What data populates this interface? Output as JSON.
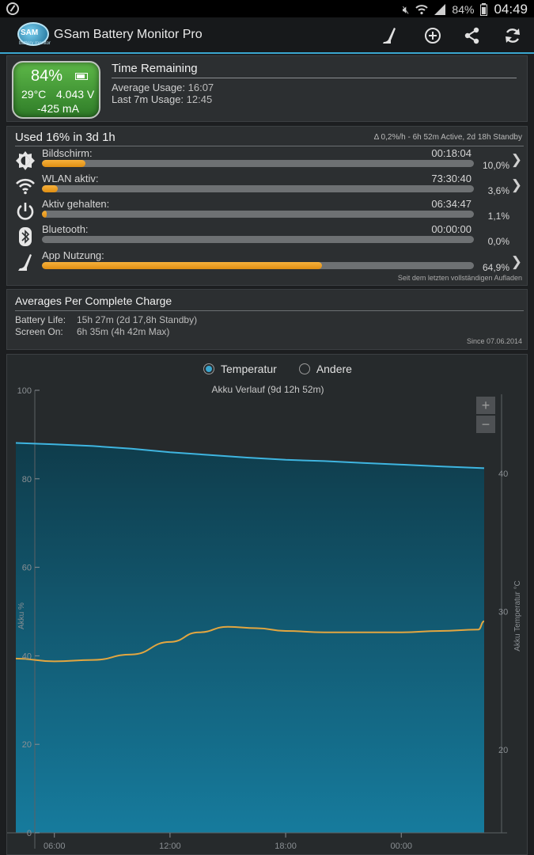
{
  "status_bar": {
    "battery": "84%",
    "time": "04:49"
  },
  "header": {
    "app_title": "GSam Battery Monitor Pro",
    "logo_text": "SAM",
    "logo_subtext": "battery monitor"
  },
  "battery_card": {
    "percent": "84%",
    "temperature": "29°C",
    "voltage": "4.043 V",
    "current": "-425 mA",
    "level": 0.84
  },
  "time_remaining": {
    "title": "Time Remaining",
    "rows": [
      {
        "label": "Average Usage:",
        "value": "16:07"
      },
      {
        "label": "Last 7m Usage:",
        "value": "12:45"
      }
    ]
  },
  "usage": {
    "title": "Used 16% in 3d 1h",
    "info": "Δ 0,2%/h - 6h 52m Active, 2d 18h Standby",
    "footer": "Seit dem letzten vollständigen Aufladen",
    "items": [
      {
        "icon": "screen-brightness-icon",
        "label": "Bildschirm:",
        "time": "00:18:04",
        "percent": "10,0%",
        "value": 10.0,
        "chevron": true
      },
      {
        "icon": "wifi-icon",
        "label": "WLAN aktiv:",
        "time": "73:30:40",
        "percent": "3,6%",
        "value": 3.6,
        "chevron": true
      },
      {
        "icon": "power-icon",
        "label": "Aktiv gehalten:",
        "time": "06:34:47",
        "percent": "1,1%",
        "value": 1.1,
        "chevron": false
      },
      {
        "icon": "bluetooth-icon",
        "label": "Bluetooth:",
        "time": "00:00:00",
        "percent": "0,0%",
        "value": 0.0,
        "chevron": false
      },
      {
        "icon": "app-usage-icon",
        "label": "App Nutzung:",
        "time": "",
        "percent": "64,9%",
        "value": 64.9,
        "chevron": true
      }
    ]
  },
  "averages": {
    "title": "Averages Per Complete Charge",
    "rows": [
      {
        "label": "Battery Life:",
        "value": "15h 27m (2d 17,8h Standby)"
      },
      {
        "label": "Screen On:",
        "value": "6h 35m (4h 42m Max)"
      }
    ],
    "since": "Since 07.06.2014"
  },
  "chart_controls": {
    "options": [
      "Temperatur",
      "Andere"
    ],
    "selected": "Temperatur",
    "zoom_in": "+",
    "zoom_out": "−"
  },
  "chart_data": {
    "type": "area",
    "title": "Akku Verlauf (9d 12h 52m)",
    "ylabel": "Akku %",
    "y2label": "Akku Temperatur °C",
    "ylim": [
      0,
      100
    ],
    "y2lim": [
      14,
      46
    ],
    "y_ticks": [
      "0",
      "20",
      "40",
      "60",
      "80",
      "100"
    ],
    "y2_ticks": [
      "20",
      "30",
      "40"
    ],
    "x_ticks": [
      "06:00",
      "12:00",
      "18:00",
      "00:00"
    ],
    "x_tick_hours": [
      6,
      12,
      18,
      24
    ],
    "x_range_hours": [
      4.0,
      28.3
    ],
    "colors": {
      "battery_line": "#3fb5e0",
      "temperature_line": "#e2a640",
      "fill_top": "#0f3c4b",
      "fill_bottom": "#167b9d"
    },
    "series": [
      {
        "name": "Akku %",
        "axis": "left",
        "x": [
          4.0,
          6.0,
          8.0,
          10.0,
          12.0,
          14.0,
          16.0,
          18.0,
          20.0,
          22.0,
          24.0,
          26.0,
          28.3
        ],
        "values": [
          88.1,
          87.8,
          87.4,
          86.8,
          86.0,
          85.4,
          84.8,
          84.3,
          84.0,
          83.6,
          83.2,
          82.8,
          82.4
        ]
      },
      {
        "name": "Akku Temperatur °C",
        "axis": "right",
        "x": [
          4.0,
          6.0,
          8.0,
          10.0,
          12.0,
          13.5,
          15.0,
          16.5,
          18.0,
          20.0,
          22.0,
          24.0,
          26.0,
          28.0,
          28.3
        ],
        "values": [
          26.6,
          26.4,
          26.5,
          26.9,
          27.8,
          28.5,
          28.9,
          28.8,
          28.6,
          28.5,
          28.5,
          28.5,
          28.6,
          28.7,
          29.3
        ]
      }
    ]
  }
}
